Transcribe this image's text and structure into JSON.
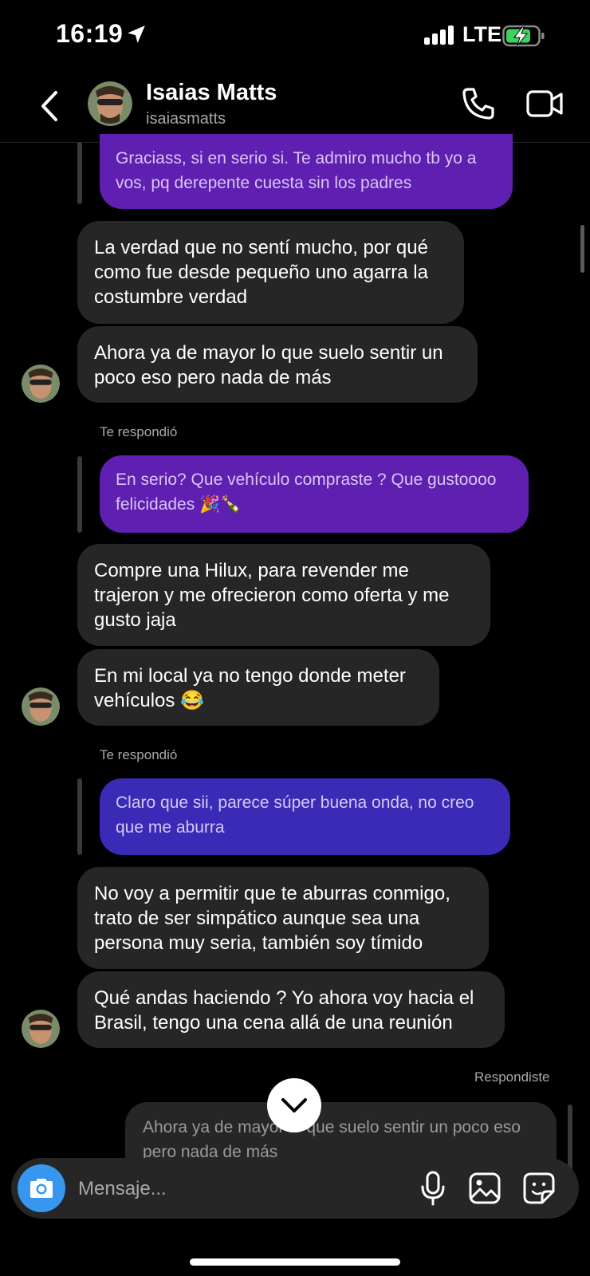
{
  "status_bar": {
    "time": "16:19",
    "network": "LTE",
    "signal_bars": 4,
    "battery_charging": true,
    "battery_level": 0.7
  },
  "header": {
    "name": "Isaias Matts",
    "username": "isaiasmatts"
  },
  "icons": {
    "back": "chevron-left-icon",
    "call": "phone-icon",
    "video": "video-camera-icon",
    "camera": "camera-icon",
    "mic": "microphone-icon",
    "gallery": "image-icon",
    "sticker": "sticker-icon",
    "scroll_down": "chevron-down-icon"
  },
  "colors": {
    "purple_quote": "#5f1fb0",
    "indigo_quote": "#3b2ab5",
    "incoming_bubble": "#262626",
    "camera_button": "#3797f0"
  },
  "messages": [
    {
      "type": "quote",
      "text": "Graciass, si en serio si. Te admiro mucho tb yo a vos, pq derepente cuesta sin los padres"
    },
    {
      "type": "incoming",
      "text": "La verdad que no sentí mucho, por qué como fue desde pequeño uno agarra la costumbre verdad"
    },
    {
      "type": "incoming",
      "text": "Ahora ya de mayor lo que suelo sentir un poco eso pero nada de más"
    },
    {
      "type": "reply_label",
      "text": "Te respondió"
    },
    {
      "type": "quote",
      "text": "En serio? Que vehículo compraste ? Que gustoooo felicidades 🎉🍾"
    },
    {
      "type": "incoming",
      "text": "Compre una Hilux, para revender me trajeron y me ofrecieron como oferta y me gusto jaja"
    },
    {
      "type": "incoming",
      "text": "En mi local ya no tengo donde meter vehículos 😂"
    },
    {
      "type": "reply_label",
      "text": "Te respondió"
    },
    {
      "type": "quote",
      "text": "Claro que sii, parece súper buena onda, no creo que me aburra"
    },
    {
      "type": "incoming",
      "text": "No voy a permitir que te aburras conmigo, trato de ser simpático aunque sea una persona muy seria, también soy tímido"
    },
    {
      "type": "incoming",
      "text": "Qué andas haciendo ? Yo ahora voy hacia el Brasil, tengo una cena allá de una reunión"
    },
    {
      "type": "reply_label",
      "text": "Respondiste"
    },
    {
      "type": "own_quote",
      "text": "Ahora ya de mayor lo que suelo sentir un poco eso pero nada de más"
    }
  ],
  "composer": {
    "placeholder": "Mensaje..."
  }
}
